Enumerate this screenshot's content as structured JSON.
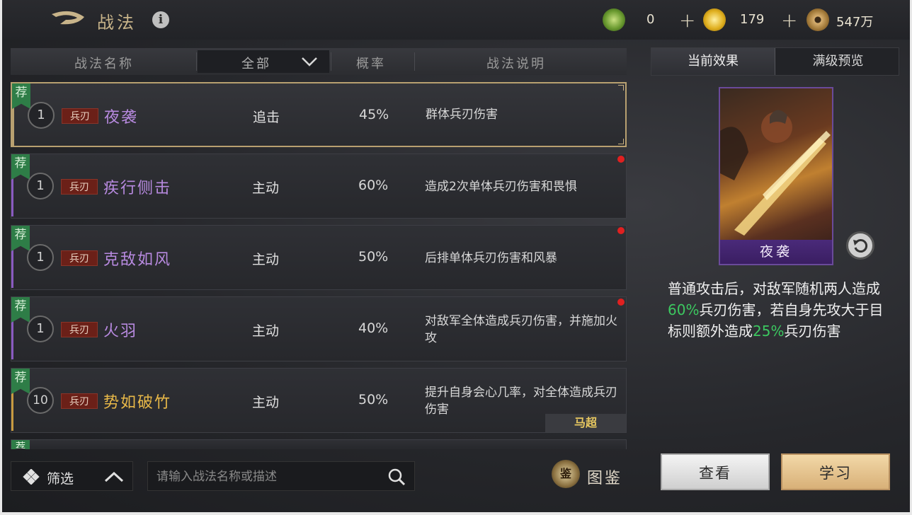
{
  "header": {
    "title": "战法",
    "info_label": "i",
    "resources": [
      {
        "icon": "jade-icon",
        "value": "0",
        "plus": "+"
      },
      {
        "icon": "gold-icon",
        "value": "179",
        "plus": "+"
      },
      {
        "icon": "copper-coin-icon",
        "value": "547万"
      }
    ]
  },
  "table": {
    "col_name": "战法名称",
    "filter_value": "全部",
    "col_rate": "概率",
    "col_desc": "战法说明",
    "rows": [
      {
        "rec": "荐",
        "level": "1",
        "tag": "兵刃",
        "name": "夜袭",
        "type": "追击",
        "rate": "45%",
        "desc": "群体兵刃伤害",
        "name_color": "#b88ae0",
        "bar_color": "#b8a070",
        "selected": true
      },
      {
        "rec": "荐",
        "level": "1",
        "tag": "兵刃",
        "name": "疾行侧击",
        "type": "主动",
        "rate": "60%",
        "desc": "造成2次单体兵刃伤害和畏惧",
        "name_color": "#b88ae0",
        "bar_color": "#8a5ac0"
      },
      {
        "rec": "荐",
        "level": "1",
        "tag": "兵刃",
        "name": "克敌如风",
        "type": "主动",
        "rate": "50%",
        "desc": "后排单体兵刃伤害和风暴",
        "name_color": "#b88ae0",
        "bar_color": "#8a5ac0"
      },
      {
        "rec": "荐",
        "level": "1",
        "tag": "兵刃",
        "name": "火羽",
        "type": "主动",
        "rate": "40%",
        "desc": "对敌军全体造成兵刃伤害，并施加火攻",
        "name_color": "#b88ae0",
        "bar_color": "#8a5ac0"
      },
      {
        "rec": "荐",
        "level": "10",
        "tag": "兵刃",
        "name": "势如破竹",
        "type": "主动",
        "rate": "50%",
        "desc": "提升自身会心几率，对全体造成兵刃伤害",
        "name_color": "#e8b848",
        "bar_color": "#c89a40",
        "hero": "马超"
      }
    ]
  },
  "bottom": {
    "filter_label": "筛选",
    "search_placeholder": "请输入战法名称或描述",
    "atlas_icon_text": "鉴",
    "atlas_label": "图鉴"
  },
  "panel": {
    "tab_current": "当前效果",
    "tab_max": "满级预览",
    "card_name": "夜袭",
    "effect_parts": [
      "普通攻击后，对敌军随机两人造成",
      "60%",
      "兵刃伤害，若自身先攻大于目标则额外造成",
      "25%",
      "兵刃伤害"
    ],
    "view_label": "查看",
    "learn_label": "学习"
  }
}
